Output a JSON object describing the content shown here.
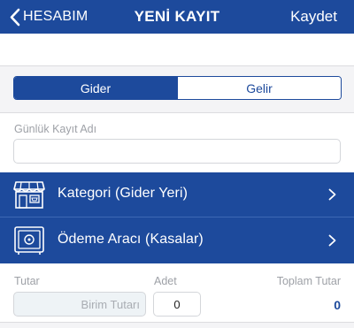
{
  "nav": {
    "back_label": "HESABIM",
    "title": "YENİ KAYIT",
    "save_label": "Kaydet"
  },
  "segments": {
    "expense_label": "Gider",
    "income_label": "Gelir",
    "selected": "Gider"
  },
  "record_name": {
    "label": "Günlük Kayıt Adı",
    "value": "",
    "placeholder": ""
  },
  "rows": {
    "category_label": "Kategori (Gider Yeri)",
    "payment_label": "Ödeme Aracı (Kasalar)"
  },
  "amount": {
    "unit_label": "Tutar",
    "unit_placeholder": "Birim Tutarı",
    "qty_label": "Adet",
    "qty_value": "0",
    "total_label": "Toplam Tutar",
    "total_value": "0"
  },
  "colors": {
    "brand_blue": "#1d4a9c",
    "background": "#f4f4f6"
  }
}
